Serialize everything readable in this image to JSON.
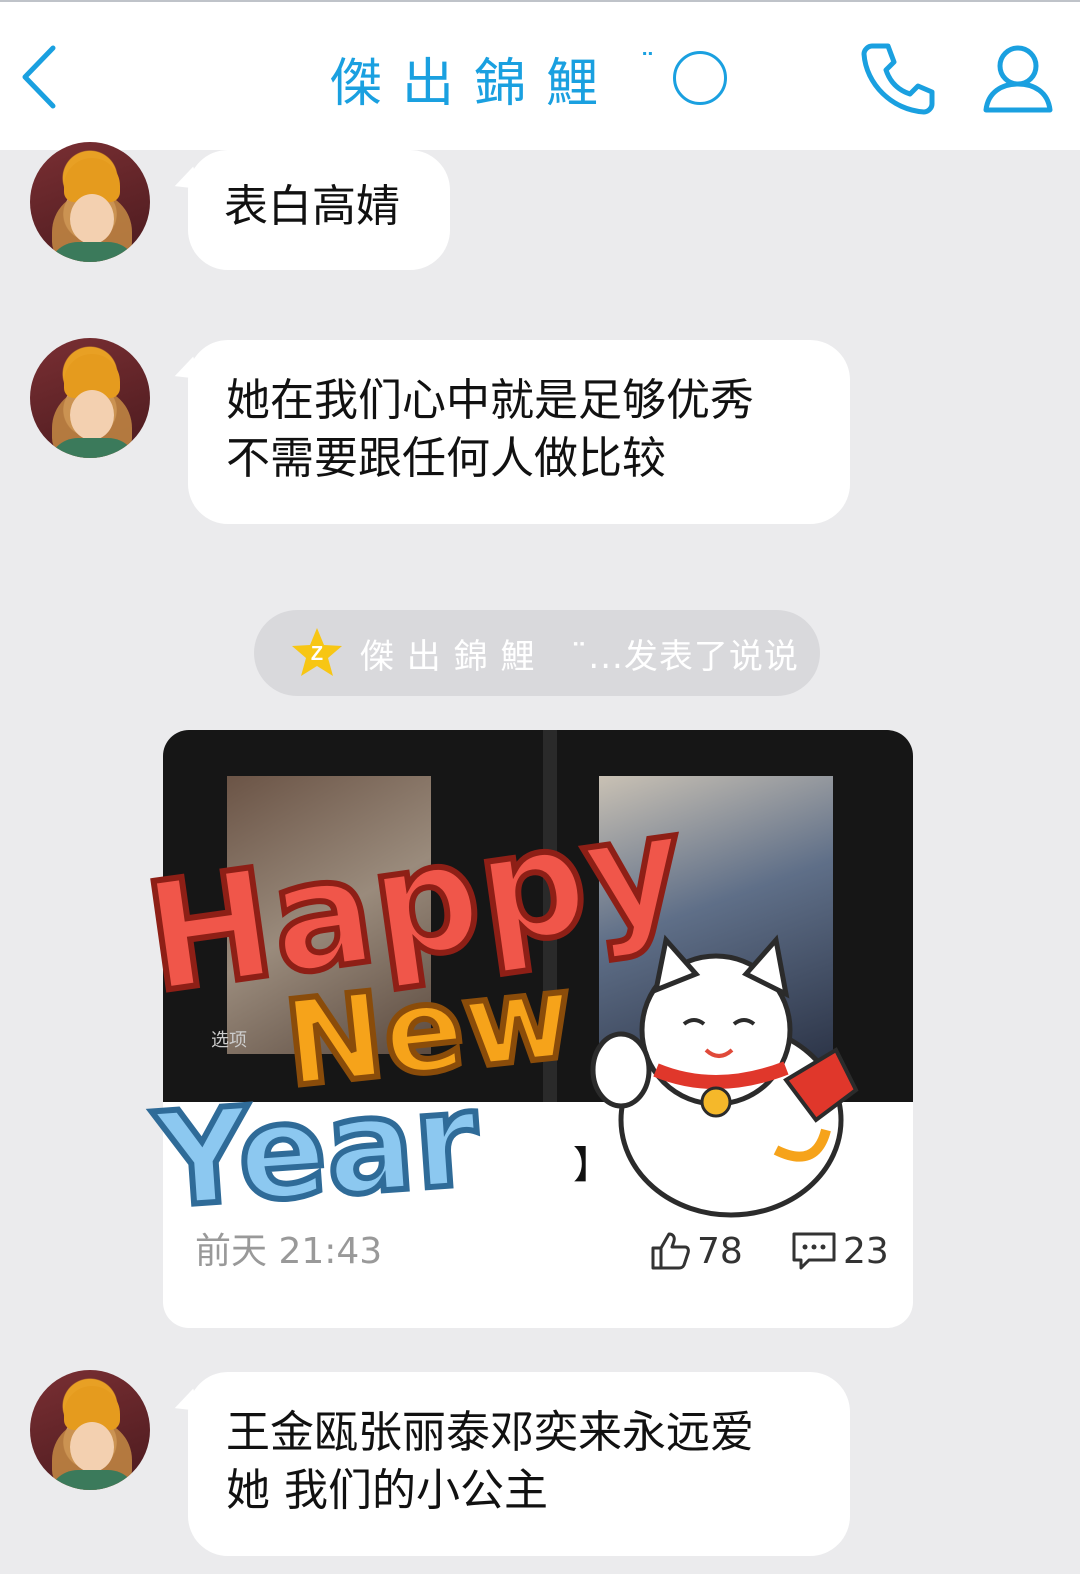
{
  "header": {
    "title": "傑出錦鯉",
    "title_decoration": "¨",
    "icons": {
      "back": "chevron-left-icon",
      "call": "phone-icon",
      "profile": "person-icon"
    },
    "accent_color": "#1aa0e0"
  },
  "messages": [
    {
      "text": "表白高婧"
    },
    {
      "lines": [
        "她在我们心中就是足够优秀",
        "不需要跟任何人做比较"
      ]
    },
    {
      "lines": [
        "王金瓯张丽泰邓奕来永远爱",
        "她 我们的小公主"
      ]
    }
  ],
  "notice": {
    "icon": "qzone-star-icon",
    "text": "傑 出 錦 鯉　¨...发表了说说"
  },
  "feed_card": {
    "photo_tag": "选项",
    "title_fragment": "】",
    "time": "前天 21:43",
    "likes": "78",
    "comments": "23",
    "sticker": {
      "lines": [
        "Happy",
        "New",
        "Year"
      ]
    }
  }
}
